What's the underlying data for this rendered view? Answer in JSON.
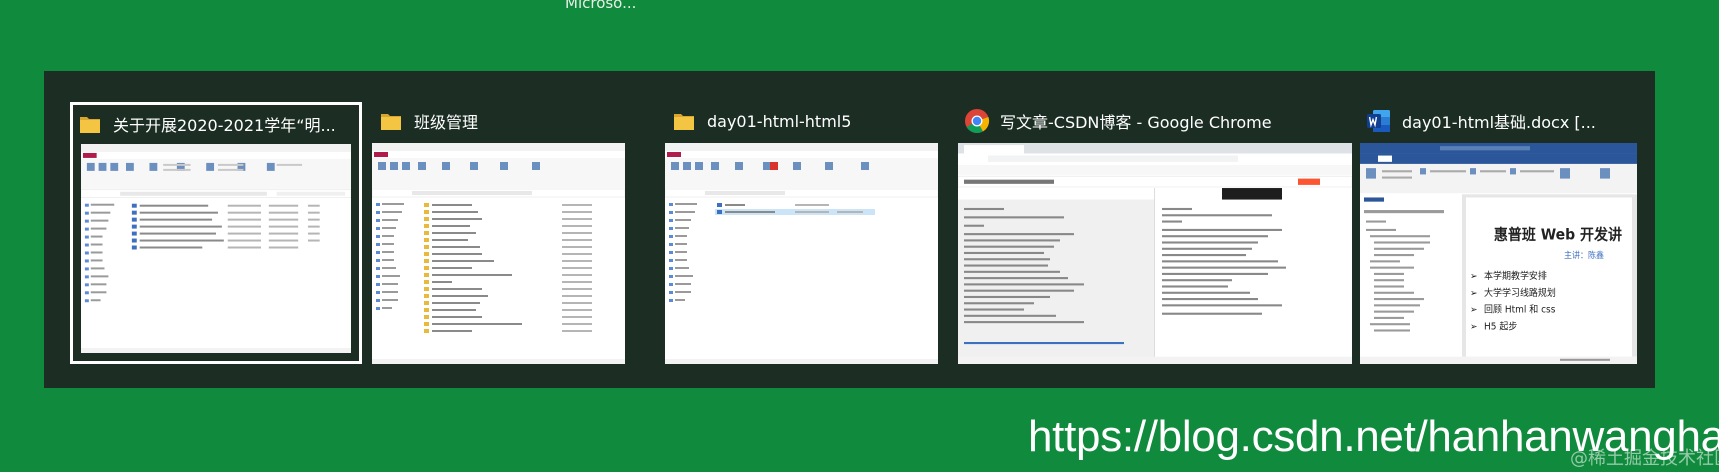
{
  "top_text": "Microso...",
  "windows": [
    {
      "title": "关于开展2020-2021学年“明...",
      "icon": "folder-icon",
      "selected": true
    },
    {
      "title": "班级管理",
      "icon": "folder-icon",
      "selected": false
    },
    {
      "title": "day01-html-html5",
      "icon": "folder-icon",
      "selected": false
    },
    {
      "title": "写文章-CSDN博客 - Google Chrome",
      "icon": "chrome-icon",
      "selected": false
    },
    {
      "title": "day01-html基础.docx [...",
      "icon": "word-icon",
      "selected": false
    }
  ],
  "word_doc": {
    "heading": "惠普班 Web 开发讲",
    "speaker": "主讲：陈鑫",
    "bullets": [
      "本学期教学安排",
      "大学学习线路规划",
      "回顾 Html 和 css",
      "H5 起步"
    ]
  },
  "watermark": "https://blog.csdn.net/hanhanwanghaha",
  "watermark_small": "@稀土掘金技术社区",
  "colors": {
    "background": "#108a3c",
    "switcher": "#1c2e24",
    "explorer_ribbon": "#b01d4a",
    "word_blue": "#2b579a",
    "folder": "#f4c542"
  }
}
